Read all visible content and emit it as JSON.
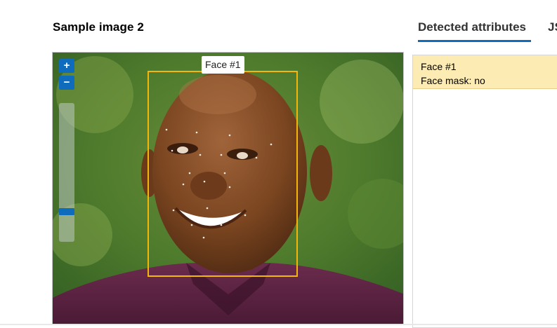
{
  "header": {
    "title": "Sample image 2"
  },
  "viewer": {
    "zoom_in": "+",
    "zoom_out": "−",
    "zoom_level": 0.2,
    "face_label": "Face #1"
  },
  "tabs": [
    {
      "label": "Detected attributes",
      "active": true
    },
    {
      "label": "JS",
      "active": false
    }
  ],
  "results": {
    "face_name": "Face #1",
    "mask_status": "Face mask: no"
  },
  "colors": {
    "accent": "#0f6cbd",
    "face_box": "#f5b50a",
    "result_bg": "#fcebb3"
  }
}
